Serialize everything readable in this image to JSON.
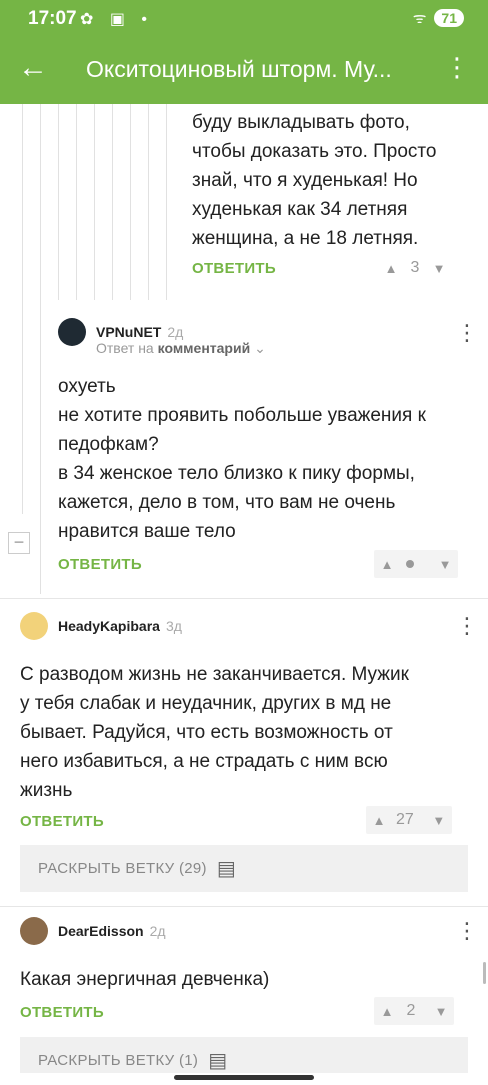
{
  "status": {
    "time": "17:07",
    "icons": "✿ ▣ •",
    "wifi": "ᯤ",
    "battery": "71"
  },
  "appbar": {
    "back": "←",
    "title": "Окситоциновый шторм. Му...",
    "menu": "⋮"
  },
  "comments": [
    {
      "text_lines": [
        "буду выкладывать фото,",
        "чтобы доказать это. Просто",
        "знай, что я худенькая! Но",
        "худенькая как 34 летняя",
        "женщина, а не 18 летняя."
      ],
      "reply_label": "ОТВЕТИТЬ",
      "score": "3"
    },
    {
      "author": "VPNuNET",
      "time_ago": "2д",
      "reply_to_prefix": "Ответ на",
      "reply_to_target": "комментарий",
      "text_lines": [
        "охуеть",
        "не хотите проявить побольше уважения к",
        "педофкам?",
        "в 34 женское тело близко к пику формы,",
        "кажется, дело в том, что вам не очень",
        "нравится ваше тело"
      ],
      "reply_label": "ОТВЕТИТЬ",
      "score": ""
    },
    {
      "author": "HeadyKapibara",
      "time_ago": "3д",
      "text_lines": [
        "С разводом жизнь не заканчивается. Мужик",
        "у тебя слабак и неудачник, других в мд не",
        "бывает. Радуйся, что есть возможность от",
        "него избавиться, а не страдать с ним всю",
        "жизнь"
      ],
      "reply_label": "ОТВЕТИТЬ",
      "score": "27",
      "expand_label": "РАСКРЫТЬ ВЕТКУ (29)"
    },
    {
      "author": "DearEdisson",
      "time_ago": "2д",
      "text_lines": [
        "Какая энергичная девченка)"
      ],
      "reply_label": "ОТВЕТИТЬ",
      "score": "2",
      "expand_label": "РАСКРЫТЬ ВЕТКУ (1)"
    }
  ],
  "colors": {
    "accent": "#75b545"
  }
}
